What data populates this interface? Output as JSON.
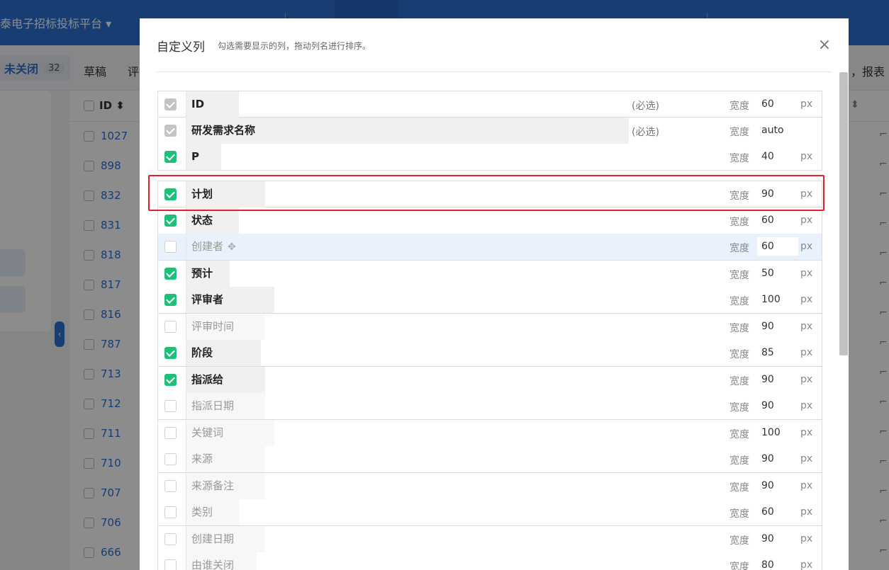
{
  "app": {
    "brand_text": "泰电子招标投标平台"
  },
  "subbar": {
    "status_tab_label": "未关闭",
    "status_tab_count": "32",
    "draft_label": "草稿",
    "review_label": "评",
    "report_label": "，报表"
  },
  "list": {
    "id_header": "ID",
    "ids": [
      "1027",
      "898",
      "832",
      "831",
      "818",
      "817",
      "816",
      "787",
      "713",
      "712",
      "711",
      "710",
      "707",
      "706",
      "666"
    ]
  },
  "modal": {
    "title": "自定义列",
    "hint": "勾选需要显示的列，拖动列名进行排序。",
    "close_symbol": "×",
    "width_label": "宽度",
    "unit_label": "px",
    "required_label": "(必选)",
    "columns": [
      {
        "name": "ID",
        "state": "locked",
        "required": true,
        "width": "60",
        "unit": true
      },
      {
        "name": "研发需求名称",
        "state": "locked",
        "required": true,
        "width": "auto",
        "unit": false
      },
      {
        "name": "P",
        "state": "on",
        "required": false,
        "width": "40",
        "unit": true
      },
      {
        "name": "计划",
        "state": "on",
        "required": false,
        "width": "90",
        "unit": true
      },
      {
        "name": "状态",
        "state": "on",
        "required": false,
        "width": "60",
        "unit": true
      },
      {
        "name": "创建者",
        "state": "off",
        "required": false,
        "width": "60",
        "unit": true,
        "hover": true
      },
      {
        "name": "预计",
        "state": "on",
        "required": false,
        "width": "50",
        "unit": true
      },
      {
        "name": "评审者",
        "state": "on",
        "required": false,
        "width": "100",
        "unit": true
      },
      {
        "name": "评审时间",
        "state": "off",
        "required": false,
        "width": "90",
        "unit": true
      },
      {
        "name": "阶段",
        "state": "on",
        "required": false,
        "width": "85",
        "unit": true
      },
      {
        "name": "指派给",
        "state": "on",
        "required": false,
        "width": "90",
        "unit": true
      },
      {
        "name": "指派日期",
        "state": "off",
        "required": false,
        "width": "90",
        "unit": true
      },
      {
        "name": "关键词",
        "state": "off",
        "required": false,
        "width": "100",
        "unit": true
      },
      {
        "name": "来源",
        "state": "off",
        "required": false,
        "width": "90",
        "unit": true
      },
      {
        "name": "来源备注",
        "state": "off",
        "required": false,
        "width": "90",
        "unit": true
      },
      {
        "name": "类别",
        "state": "off",
        "required": false,
        "width": "60",
        "unit": true
      },
      {
        "name": "创建日期",
        "state": "off",
        "required": false,
        "width": "90",
        "unit": true
      },
      {
        "name": "由谁关闭",
        "state": "off",
        "required": false,
        "width": "80",
        "unit": true
      }
    ]
  }
}
